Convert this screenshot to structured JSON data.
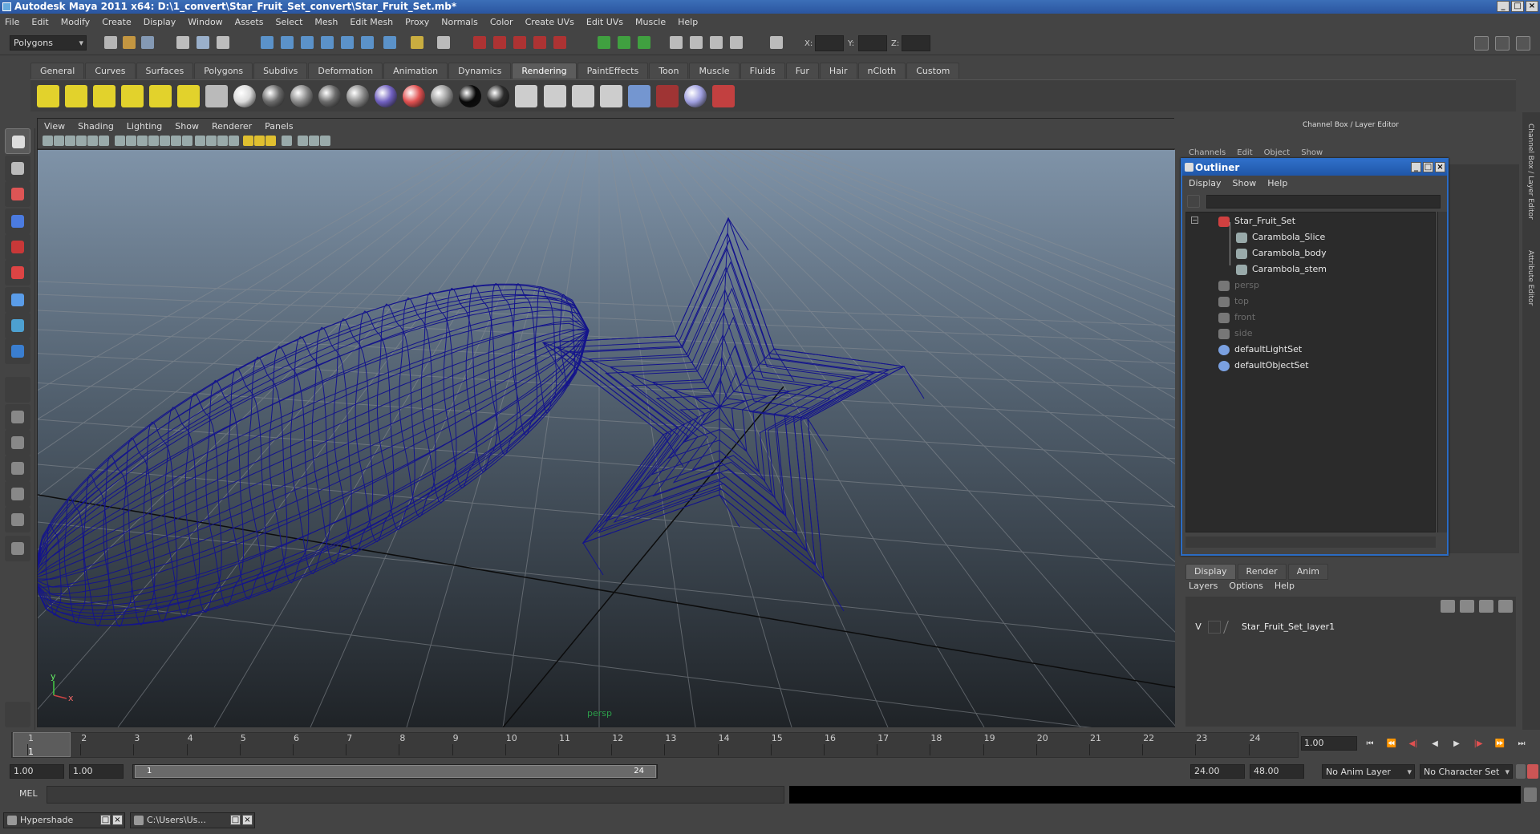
{
  "window": {
    "title": "Autodesk Maya 2011 x64: D:\\1_convert\\Star_Fruit_Set_convert\\Star_Fruit_Set.mb*"
  },
  "menubar": [
    "File",
    "Edit",
    "Modify",
    "Create",
    "Display",
    "Window",
    "Assets",
    "Select",
    "Mesh",
    "Edit Mesh",
    "Proxy",
    "Normals",
    "Color",
    "Create UVs",
    "Edit UVs",
    "Muscle",
    "Help"
  ],
  "statusline": {
    "mode": "Polygons",
    "x_label": "X:",
    "y_label": "Y:",
    "z_label": "Z:"
  },
  "shelf": {
    "tabs": [
      "General",
      "Curves",
      "Surfaces",
      "Polygons",
      "Subdivs",
      "Deformation",
      "Animation",
      "Dynamics",
      "Rendering",
      "PaintEffects",
      "Toon",
      "Muscle",
      "Fluids",
      "Fur",
      "Hair",
      "nCloth",
      "Custom"
    ],
    "active": "Rendering"
  },
  "viewport": {
    "menu": [
      "View",
      "Shading",
      "Lighting",
      "Show",
      "Renderer",
      "Panels"
    ],
    "camera": "persp",
    "axis_x": "x",
    "axis_y": "y",
    "wire_color": "#14148c"
  },
  "channelbox": {
    "title": "Channel Box / Layer Editor",
    "menu": [
      "Channels",
      "Edit",
      "Object",
      "Show"
    ]
  },
  "outliner": {
    "title": "Outliner",
    "menu": [
      "Display",
      "Show",
      "Help"
    ],
    "items": [
      {
        "label": "Star_Fruit_Set",
        "indent": 0,
        "dim": false,
        "icon": "transform-icon"
      },
      {
        "label": "Carambola_Slice",
        "indent": 1,
        "dim": false,
        "icon": "mesh-icon"
      },
      {
        "label": "Carambola_body",
        "indent": 1,
        "dim": false,
        "icon": "mesh-icon"
      },
      {
        "label": "Carambola_stem",
        "indent": 1,
        "dim": false,
        "icon": "mesh-icon"
      },
      {
        "label": "persp",
        "indent": 0,
        "dim": true,
        "icon": "camera-icon"
      },
      {
        "label": "top",
        "indent": 0,
        "dim": true,
        "icon": "camera-icon"
      },
      {
        "label": "front",
        "indent": 0,
        "dim": true,
        "icon": "camera-icon"
      },
      {
        "label": "side",
        "indent": 0,
        "dim": true,
        "icon": "camera-icon"
      },
      {
        "label": "defaultLightSet",
        "indent": 0,
        "dim": false,
        "icon": "set-icon"
      },
      {
        "label": "defaultObjectSet",
        "indent": 0,
        "dim": false,
        "icon": "set-icon"
      }
    ]
  },
  "layers": {
    "tabs": [
      "Display",
      "Render",
      "Anim"
    ],
    "active": "Display",
    "menu": [
      "Layers",
      "Options",
      "Help"
    ],
    "row": {
      "visible": "V",
      "name": "Star_Fruit_Set_layer1"
    }
  },
  "side_tabs": [
    "Channel Box / Layer Editor",
    "Attribute Editor"
  ],
  "timeline": {
    "ticks": [
      "1",
      "2",
      "3",
      "4",
      "5",
      "6",
      "7",
      "8",
      "9",
      "10",
      "11",
      "12",
      "13",
      "14",
      "15",
      "16",
      "17",
      "18",
      "19",
      "20",
      "21",
      "22",
      "23",
      "24"
    ],
    "current_marker": "1",
    "current": "1.00"
  },
  "range": {
    "start": "1.00",
    "start_inner": "1.00",
    "slider_start": "1",
    "slider_end": "24",
    "end_inner": "24.00",
    "end": "48.00",
    "anim_layer": "No Anim Layer",
    "char_set": "No Character Set"
  },
  "cmdline": {
    "label": "MEL"
  },
  "taskbar": [
    {
      "label": "Hypershade"
    },
    {
      "label": "C:\\Users\\Us..."
    }
  ]
}
